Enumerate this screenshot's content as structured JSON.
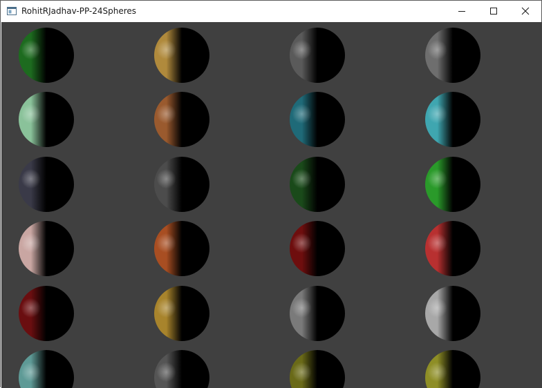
{
  "window": {
    "title": "RohitRJadhav-PP-24Spheres",
    "app_icon": "app-window-icon",
    "controls": [
      {
        "name": "minimize-button",
        "icon": "minimize-icon"
      },
      {
        "name": "maximize-button",
        "icon": "maximize-icon"
      },
      {
        "name": "close-button",
        "icon": "close-icon"
      }
    ]
  },
  "scene": {
    "background": "#404040",
    "rows": 6,
    "columns": 4,
    "sphere_colors": [
      [
        "#1d6b1f",
        "#b08a3c",
        "#5a5a5a",
        "#6e6e6e"
      ],
      [
        "#8ac29a",
        "#9a5a2e",
        "#1f6a78",
        "#3fa6b0"
      ],
      [
        "#3a3a48",
        "#4c4c4c",
        "#1a4a1a",
        "#2a9a2a"
      ],
      [
        "#c9a6a2",
        "#a84e22",
        "#6e0e0e",
        "#b83030"
      ],
      [
        "#6a0e10",
        "#a8842c",
        "#7a7a7a",
        "#a8a8a8"
      ],
      [
        "#5e9a96",
        "#555555",
        "#6a6a18",
        "#8e8e26"
      ]
    ]
  }
}
